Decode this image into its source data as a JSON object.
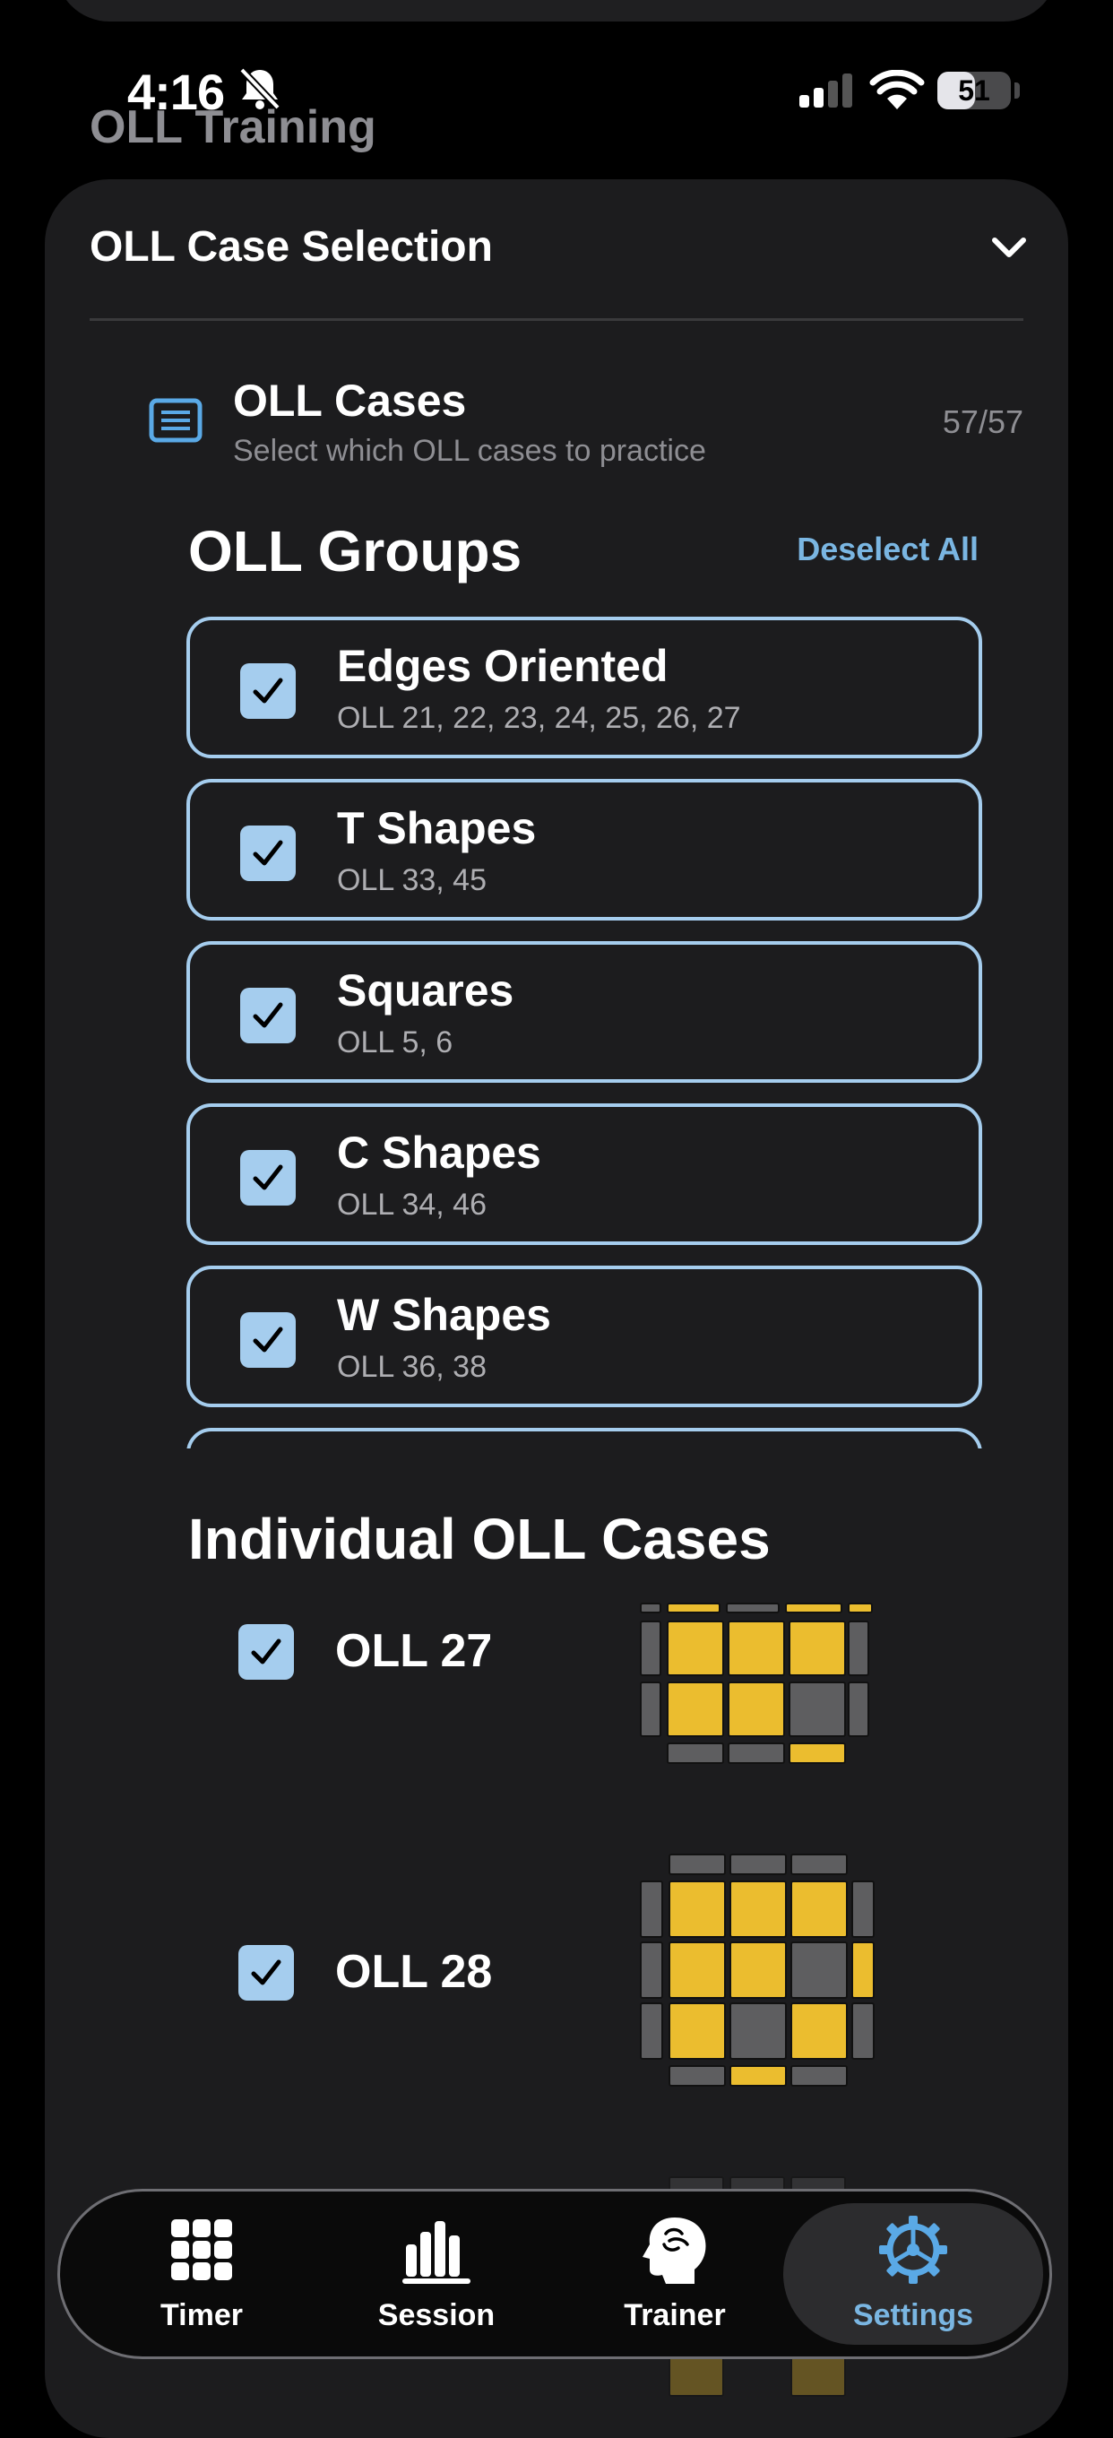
{
  "status_bar": {
    "time": "4:16",
    "battery": "51",
    "battery_level": 0.51
  },
  "nav": {
    "title": "OLL Training"
  },
  "section": {
    "title": "OLL Case Selection"
  },
  "cases_header": {
    "title": "OLL Cases",
    "subtitle": "Select which OLL cases to practice",
    "count": "57/57"
  },
  "groups": {
    "title": "OLL Groups",
    "deselect_label": "Deselect All",
    "items": [
      {
        "name": "Edges Oriented",
        "cases": "OLL 21, 22, 23, 24, 25, 26, 27",
        "checked": true
      },
      {
        "name": "T Shapes",
        "cases": "OLL 33, 45",
        "checked": true
      },
      {
        "name": "Squares",
        "cases": "OLL 5, 6",
        "checked": true
      },
      {
        "name": "C Shapes",
        "cases": "OLL 34, 46",
        "checked": true
      },
      {
        "name": "W Shapes",
        "cases": "OLL 36, 38",
        "checked": true
      }
    ]
  },
  "individual": {
    "title": "Individual OLL Cases",
    "items": [
      {
        "name": "OLL 27",
        "checked": true,
        "top": [
          "g",
          "y",
          "g",
          "y"
        ],
        "left": [
          "g",
          "g"
        ],
        "right": [
          "g",
          "g"
        ],
        "bottom": [
          "g",
          "g",
          "y"
        ],
        "face": [
          [
            "y",
            "y",
            "y"
          ],
          [
            "y",
            "y",
            "g"
          ]
        ]
      },
      {
        "name": "OLL 28",
        "checked": true,
        "top": [
          "g",
          "g",
          "g"
        ],
        "left": [
          "g",
          "g",
          "g"
        ],
        "right": [
          "g",
          "y",
          "g"
        ],
        "bottom": [
          "g",
          "y",
          "g"
        ],
        "face": [
          [
            "y",
            "y",
            "y"
          ],
          [
            "y",
            "y",
            "g"
          ],
          [
            "y",
            "g",
            "y"
          ]
        ]
      }
    ]
  },
  "tabs": [
    {
      "label": "Timer",
      "icon": "grid-icon",
      "active": false
    },
    {
      "label": "Session",
      "icon": "bar-chart-icon",
      "active": false
    },
    {
      "label": "Trainer",
      "icon": "brain-head-icon",
      "active": false
    },
    {
      "label": "Settings",
      "icon": "gear-icon",
      "active": true
    }
  ],
  "colors": {
    "accent": "#7ab6e2",
    "checkbox": "#a5cdee",
    "sticker_yellow": "#ebbd2f",
    "sticker_gray": "#5e5e60",
    "card_bg": "#1c1c1e"
  }
}
